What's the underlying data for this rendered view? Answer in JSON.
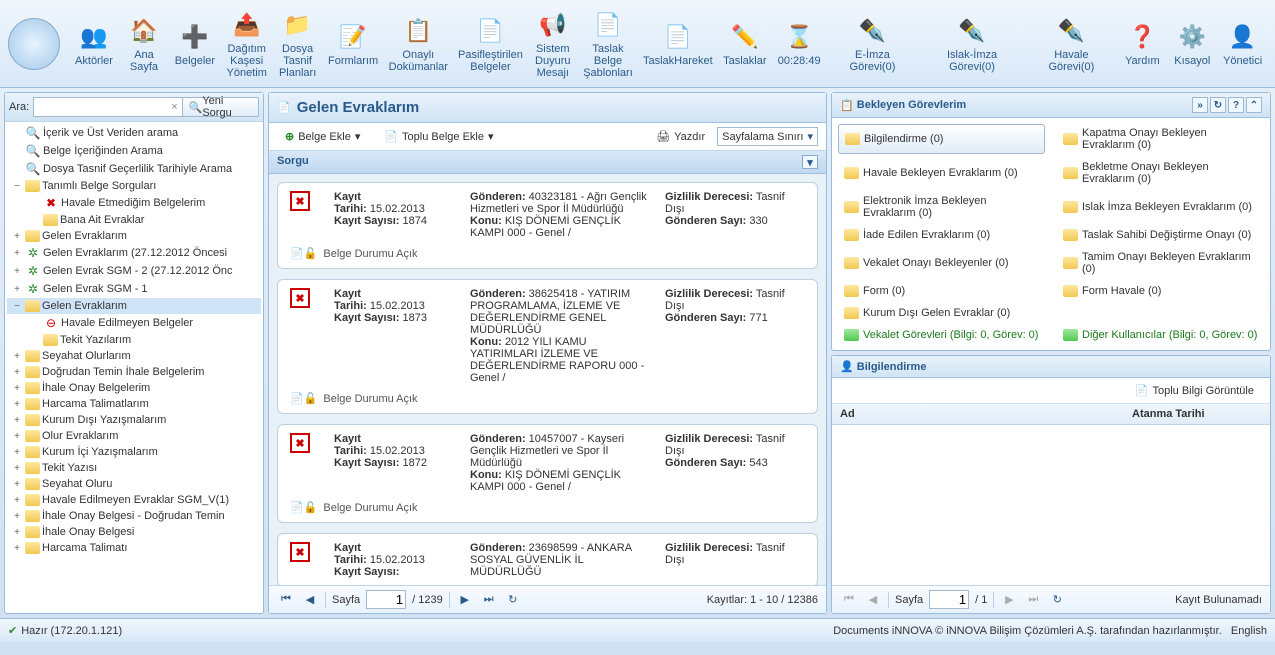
{
  "toolbar": [
    {
      "label": "Aktörler"
    },
    {
      "label": "Ana\nSayfa"
    },
    {
      "label": "Belgeler"
    },
    {
      "label": "Dağıtım\nKaşesi\nYönetim"
    },
    {
      "label": "Dosya\nTasnif\nPlanları"
    },
    {
      "label": "Formlarım"
    },
    {
      "label": "Onaylı\nDokümanlar"
    },
    {
      "label": "Pasifleştirilen\nBelgeler"
    },
    {
      "label": "Sistem\nDuyuru\nMesajı"
    },
    {
      "label": "Taslak\nBelge\nŞablonları"
    },
    {
      "label": "TaslakHareket"
    },
    {
      "label": "Taslaklar"
    },
    {
      "label": "00:28:49"
    },
    {
      "label": "E-İmza Görevi(0)"
    },
    {
      "label": "Islak-İmza Görevi(0)"
    },
    {
      "label": "Havale Görevi(0)"
    },
    {
      "label": "Yardım"
    },
    {
      "label": "Kısayol"
    },
    {
      "label": "Yönetici"
    }
  ],
  "search": {
    "label": "Ara:",
    "placeholder": "",
    "clear": "×",
    "newQuery": "Yeni Sorgu"
  },
  "tree": [
    {
      "ind": 0,
      "exp": "",
      "icon": "search",
      "text": "İçerik ve Üst Veriden arama"
    },
    {
      "ind": 0,
      "exp": "",
      "icon": "search",
      "text": "Belge İçeriğinden Arama"
    },
    {
      "ind": 0,
      "exp": "",
      "icon": "search",
      "text": "Dosya Tasnif Geçerlilik Tarihiyle Arama"
    },
    {
      "ind": 0,
      "exp": "−",
      "icon": "folder-open",
      "text": "Tanımlı Belge Sorguları"
    },
    {
      "ind": 1,
      "exp": "",
      "icon": "red",
      "glyph": "✖",
      "text": "Havale Etmediğim Belgelerim"
    },
    {
      "ind": 1,
      "exp": "",
      "icon": "folder",
      "text": "Bana Ait Evraklar"
    },
    {
      "ind": 0,
      "exp": "+",
      "icon": "folder",
      "text": "Gelen Evraklarım"
    },
    {
      "ind": 0,
      "exp": "+",
      "icon": "green",
      "glyph": "✲",
      "text": "Gelen Evraklarım (27.12.2012 Öncesi"
    },
    {
      "ind": 0,
      "exp": "+",
      "icon": "green",
      "glyph": "✲",
      "text": "Gelen Evrak SGM - 2 (27.12.2012 Önc"
    },
    {
      "ind": 0,
      "exp": "+",
      "icon": "green",
      "glyph": "✲",
      "text": "Gelen Evrak SGM - 1"
    },
    {
      "ind": 0,
      "exp": "−",
      "icon": "folder-open",
      "text": "Gelen Evraklarım",
      "selected": true
    },
    {
      "ind": 1,
      "exp": "",
      "icon": "red",
      "glyph": "⊖",
      "text": "Havale Edilmeyen Belgeler"
    },
    {
      "ind": 1,
      "exp": "",
      "icon": "folder",
      "text": "Tekit Yazılarım"
    },
    {
      "ind": 0,
      "exp": "+",
      "icon": "folder",
      "text": "Seyahat Olurlarım"
    },
    {
      "ind": 0,
      "exp": "+",
      "icon": "folder",
      "text": "Doğrudan Temin İhale Belgelerim"
    },
    {
      "ind": 0,
      "exp": "+",
      "icon": "folder",
      "text": "İhale Onay Belgelerim"
    },
    {
      "ind": 0,
      "exp": "+",
      "icon": "folder",
      "text": "Harcama Talimatlarım"
    },
    {
      "ind": 0,
      "exp": "+",
      "icon": "folder",
      "text": "Kurum Dışı Yazışmalarım"
    },
    {
      "ind": 0,
      "exp": "+",
      "icon": "folder",
      "text": "Olur Evraklarım"
    },
    {
      "ind": 0,
      "exp": "+",
      "icon": "folder",
      "text": "Kurum İçi Yazışmalarım"
    },
    {
      "ind": 0,
      "exp": "+",
      "icon": "folder",
      "text": "Tekit Yazısı"
    },
    {
      "ind": 0,
      "exp": "+",
      "icon": "folder",
      "text": "Seyahat Oluru"
    },
    {
      "ind": 0,
      "exp": "+",
      "icon": "folder",
      "text": "Havale Edilmeyen Evraklar SGM_V(1)"
    },
    {
      "ind": 0,
      "exp": "+",
      "icon": "folder",
      "text": "İhale Onay Belgesi - Doğrudan Temin"
    },
    {
      "ind": 0,
      "exp": "+",
      "icon": "folder",
      "text": "İhale Onay Belgesi"
    },
    {
      "ind": 0,
      "exp": "+",
      "icon": "folder",
      "text": "Harcama Talimatı"
    }
  ],
  "center": {
    "title": "Gelen Evraklarım",
    "belgeEkle": "Belge Ekle",
    "topluBelgeEkle": "Toplu Belge Ekle",
    "yazdir": "Yazdır",
    "sayfalama": "Sayfalama Sınırı",
    "sorgu": "Sorgu",
    "records": [
      {
        "kayit": "Kayıt",
        "tarihi": "Tarihi:",
        "tarihiV": "15.02.2013",
        "kayitSayisi": "Kayıt Sayısı:",
        "kayitSayisiV": "1874",
        "gonderen": "Gönderen:",
        "gonderenV": "40323181 - Ağrı Gençlik Hizmetleri ve Spor İl Müdürlüğü",
        "konu": "Konu:",
        "konuV": "KIŞ DÖNEMİ GENÇLİK KAMPI 000 - Genel /",
        "gizlilik": "Gizlilik Derecesi:",
        "gizlilikV": "Tasnif Dışı",
        "gonderenSayi": "Gönderen Sayı:",
        "gonderenSayiV": "330",
        "status": "Belge Durumu Açık"
      },
      {
        "kayit": "Kayıt",
        "tarihi": "Tarihi:",
        "tarihiV": "15.02.2013",
        "kayitSayisi": "Kayıt Sayısı:",
        "kayitSayisiV": "1873",
        "gonderen": "Gönderen:",
        "gonderenV": "38625418 - YATIRIM PROGRAMLAMA, İZLEME VE DEĞERLENDİRME GENEL MÜDÜRLÜĞÜ",
        "konu": "Konu:",
        "konuV": "2012 YILI KAMU YATIRIMLARI İZLEME VE DEĞERLENDİRME RAPORU 000 - Genel /",
        "gizlilik": "Gizlilik Derecesi:",
        "gizlilikV": "Tasnif Dışı",
        "gonderenSayi": "Gönderen Sayı:",
        "gonderenSayiV": "771",
        "status": "Belge Durumu Açık"
      },
      {
        "kayit": "Kayıt",
        "tarihi": "Tarihi:",
        "tarihiV": "15.02.2013",
        "kayitSayisi": "Kayıt Sayısı:",
        "kayitSayisiV": "1872",
        "gonderen": "Gönderen:",
        "gonderenV": "10457007 - Kayseri Gençlik Hizmetleri ve Spor İl Müdürlüğü",
        "konu": "Konu:",
        "konuV": "KIŞ DÖNEMİ GENÇLİK KAMPI 000 - Genel /",
        "gizlilik": "Gizlilik Derecesi:",
        "gizlilikV": "Tasnif Dışı",
        "gonderenSayi": "Gönderen Sayı:",
        "gonderenSayiV": "543",
        "status": "Belge Durumu Açık"
      },
      {
        "kayit": "Kayıt",
        "tarihi": "Tarihi:",
        "tarihiV": "15.02.2013",
        "kayitSayisi": "Kayıt Sayısı:",
        "kayitSayisiV": "",
        "gonderen": "Gönderen:",
        "gonderenV": "23698599 - ANKARA SOSYAL GÜVENLİK İL MÜDÜRLÜĞÜ",
        "konu": "",
        "konuV": "",
        "gizlilik": "Gizlilik Derecesi:",
        "gizlilikV": "Tasnif Dışı",
        "gonderenSayi": "",
        "gonderenSayiV": "",
        "status": ""
      }
    ],
    "paging": {
      "sayfa": "Sayfa",
      "page": "1",
      "total": "/ 1239",
      "kayitlar": "Kayıtlar: 1 - 10 / 12386"
    }
  },
  "tasks": {
    "header": "Bekleyen Görevlerim",
    "items": [
      {
        "t": "Bilgilendirme (0)",
        "sel": true
      },
      {
        "t": "Kapatma Onayı Bekleyen Evraklarım (0)"
      },
      {
        "t": "Havale Bekleyen Evraklarım (0)"
      },
      {
        "t": "Bekletme Onayı Bekleyen Evraklarım (0)"
      },
      {
        "t": "Elektronik İmza Bekleyen Evraklarım (0)"
      },
      {
        "t": "Islak İmza Bekleyen Evraklarım (0)"
      },
      {
        "t": "İade Edilen Evraklarım (0)"
      },
      {
        "t": "Taslak Sahibi Değiştirme Onayı (0)"
      },
      {
        "t": "Vekalet Onayı Bekleyenler (0)"
      },
      {
        "t": "Tamim Onayı Bekleyen Evraklarım (0)"
      },
      {
        "t": "Form (0)"
      },
      {
        "t": "Form Havale (0)"
      },
      {
        "t": "Kurum Dışı Gelen Evraklar (0)"
      },
      {
        "t": ""
      },
      {
        "t": "Vekalet Görevleri (Bilgi: 0, Görev: 0)",
        "green": true
      },
      {
        "t": "Diğer Kullanıcılar (Bilgi: 0, Görev: 0)",
        "green": true
      }
    ]
  },
  "info": {
    "header": "Bilgilendirme",
    "topluBilgi": "Toplu Bilgi Görüntüle",
    "colAd": "Ad",
    "colTarih": "Atanma Tarihi",
    "paging": {
      "sayfa": "Sayfa",
      "page": "1",
      "total": "/ 1",
      "noRec": "Kayıt Bulunamadı"
    }
  },
  "status": {
    "ready": "Hazır (172.20.1.121)",
    "footer": "Documents iNNOVA © iNNOVA Bilişim Çözümleri A.Ş. tarafından hazırlanmıştır.",
    "lang": "English"
  }
}
